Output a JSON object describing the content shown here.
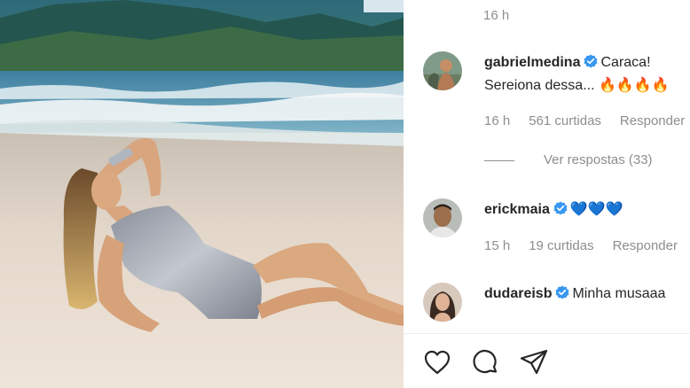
{
  "post": {
    "top_timestamp": "16 h"
  },
  "comments": [
    {
      "username": "gabrielmedina",
      "verified": true,
      "text_line1": "Caraca!",
      "text_line2": "Sereiona dessa... 🔥🔥🔥🔥",
      "time": "16 h",
      "likes": "561 curtidas",
      "reply": "Responder",
      "view_replies": "Ver respostas (33)"
    },
    {
      "username": "erickmaia",
      "verified": true,
      "text": "💙💙💙",
      "time": "15 h",
      "likes": "19 curtidas",
      "reply": "Responder"
    },
    {
      "username": "dudareisb",
      "verified": true,
      "text": "Minha musaaa"
    }
  ],
  "actions": {
    "like_icon": "heart-icon",
    "comment_icon": "comment-icon",
    "share_icon": "share-icon"
  },
  "colors": {
    "verified_blue": "#3897f0",
    "secondary_text": "#8e8e8e",
    "primary_text": "#262626"
  }
}
